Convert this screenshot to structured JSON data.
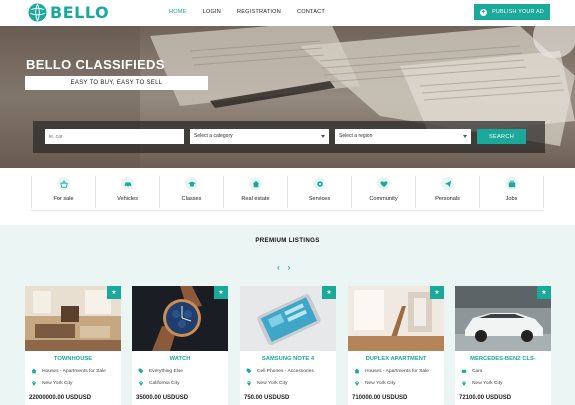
{
  "brand": {
    "name": "BELLO"
  },
  "nav": [
    {
      "label": "HOME",
      "active": true
    },
    {
      "label": "LOGIN",
      "active": false
    },
    {
      "label": "REGISTRATION",
      "active": false
    },
    {
      "label": "CONTACT",
      "active": false
    }
  ],
  "publish_label": "PUBLISH YOUR AD",
  "hero": {
    "title": "BELLO CLASSIFIEDS",
    "subtitle": "EASY TO BUY, EASY TO SELL"
  },
  "search": {
    "placeholder": "ie. car",
    "category_select": "Select a category",
    "region_select": "Select a region",
    "button": "SEARCH"
  },
  "categories": [
    {
      "label": "For sale",
      "icon": "shopping-basket-icon"
    },
    {
      "label": "Vehicles",
      "icon": "car-icon"
    },
    {
      "label": "Classes",
      "icon": "graduation-cap-icon"
    },
    {
      "label": "Real estate",
      "icon": "home-icon"
    },
    {
      "label": "Services",
      "icon": "cog-icon"
    },
    {
      "label": "Community",
      "icon": "heart-icon"
    },
    {
      "label": "Personals",
      "icon": "paper-plane-icon"
    },
    {
      "label": "Jobs",
      "icon": "briefcase-icon"
    }
  ],
  "premium": {
    "title": "PREMIUM LISTINGS",
    "prev": "‹",
    "next": "›",
    "listings": [
      {
        "title": "TOWNHOUSE",
        "category": "Houses - Apartments for Sale",
        "location": "New York City",
        "price": "22000000.00 USDUSD",
        "image": "living-room"
      },
      {
        "title": "WATCH",
        "category": "Everything Else",
        "location": "California City",
        "price": "35000.00 USDUSD",
        "image": "watch"
      },
      {
        "title": "SAMSUNG NOTE 4",
        "category": "Cell Phones - Accessories",
        "location": "New York City",
        "price": "750.00 USDUSD",
        "image": "phone"
      },
      {
        "title": "DUPLEX APARTMENT",
        "category": "Houses - Apartments for Sale",
        "location": "New York City",
        "price": "710000.00 USDUSD",
        "image": "apartment"
      },
      {
        "title": "MERCEDES-BENZ CLS-",
        "category": "Cars",
        "location": "New York City",
        "price": "72100.00 USDUSD",
        "image": "car"
      }
    ]
  },
  "colors": {
    "accent": "#1aa99a",
    "premium_bg": "#eaf5f4"
  }
}
